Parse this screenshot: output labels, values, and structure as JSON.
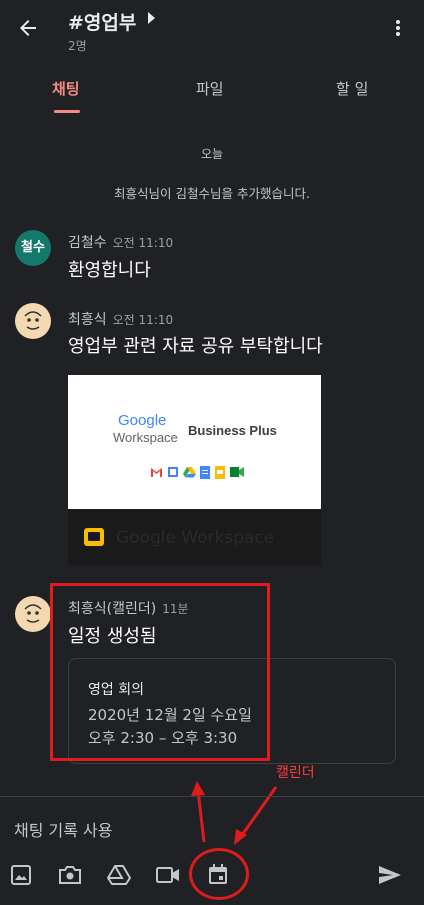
{
  "header": {
    "title": "#영업부",
    "members": "2명"
  },
  "tabs": [
    {
      "label": "채팅",
      "active": true
    },
    {
      "label": "파일",
      "active": false
    },
    {
      "label": "할 일",
      "active": false
    }
  ],
  "chat": {
    "date_separator": "오늘",
    "system_message": "최흥식님이 김철수님을 추가했습니다.",
    "messages": [
      {
        "avatar_text": "철수",
        "sender": "김철수",
        "time": "오전 11:10",
        "text": "환영합니다"
      },
      {
        "sender": "최흥식",
        "time": "오전 11:10",
        "text": "영업부 관련 자료 공유 부탁합니다",
        "attachment": {
          "google": "Google",
          "workspace": "Workspace",
          "plan": "Business Plus",
          "file_name": "Google Workspace"
        }
      },
      {
        "sender": "최흥식(캘린더)",
        "time": "11분",
        "text": "일정 생성됨",
        "event": {
          "title": "영업 회의",
          "date": "2020년 12월 2일 수요일",
          "time": "오후 2:30 – 오후 3:30"
        }
      }
    ]
  },
  "annotation": {
    "label": "캘린더",
    "color": "#e01b1b"
  },
  "composer": {
    "placeholder": "채팅 기록 사용"
  },
  "toolbar": [
    "image-icon",
    "camera-icon",
    "drive-icon",
    "video-icon",
    "calendar-icon",
    "send-icon"
  ],
  "colors": {
    "background": "#202124",
    "accent": "#f28b82",
    "annotation": "#e01b1b"
  }
}
